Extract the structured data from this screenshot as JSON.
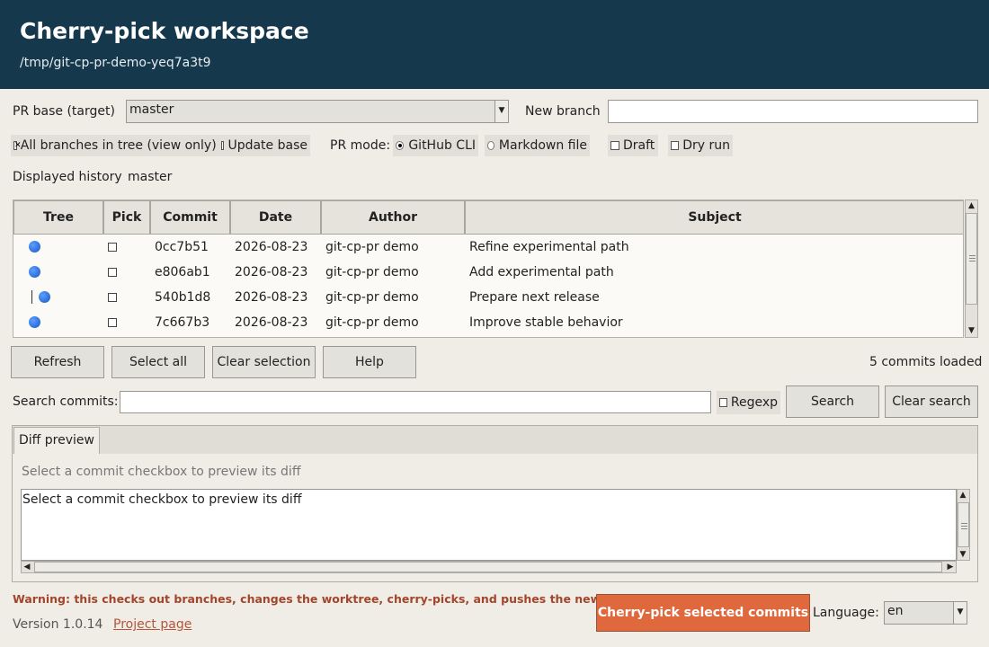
{
  "header": {
    "title": "Cherry-pick workspace",
    "repo_path": "/tmp/git-cp-pr-demo-yeq7a3t9"
  },
  "form": {
    "pr_base_label": "PR base (target)",
    "pr_base_value": "master",
    "new_branch_label": "New branch",
    "new_branch_value": "",
    "all_branches_label": "All branches in tree (view only)",
    "update_base_label": "Update base",
    "pr_mode_label": "PR mode:",
    "github_cli_label": "GitHub CLI",
    "markdown_file_label": "Markdown file",
    "draft_label": "Draft",
    "dry_run_label": "Dry run",
    "displayed_history_label": "Displayed history",
    "displayed_history_value": "master"
  },
  "table": {
    "columns": [
      "Tree",
      "Pick",
      "Commit",
      "Date",
      "Author",
      "Subject"
    ],
    "rows": [
      {
        "tree": "dot",
        "commit": "0cc7b51",
        "date": "2026-08-23",
        "author": "git-cp-pr demo",
        "subject": "Refine experimental path"
      },
      {
        "tree": "dot",
        "commit": "e806ab1",
        "date": "2026-08-23",
        "author": "git-cp-pr demo",
        "subject": "Add experimental path"
      },
      {
        "tree": "bar-dot",
        "commit": "540b1d8",
        "date": "2026-08-23",
        "author": "git-cp-pr demo",
        "subject": "Prepare next release"
      },
      {
        "tree": "dot",
        "commit": "7c667b3",
        "date": "2026-08-23",
        "author": "git-cp-pr demo",
        "subject": "Improve stable behavior"
      }
    ]
  },
  "actions": {
    "refresh": "Refresh",
    "select_all": "Select all",
    "clear_selection": "Clear selection",
    "help": "Help",
    "status": "5 commits loaded"
  },
  "search": {
    "label": "Search commits:",
    "value": "",
    "regexp_label": "Regexp",
    "search_button": "Search",
    "clear_button": "Clear search"
  },
  "diff": {
    "tab_label": "Diff preview",
    "hint": "Select a commit checkbox to preview its diff",
    "content": "Select a commit checkbox to preview its diff"
  },
  "footer": {
    "warning": "Warning: this checks out branches, changes the worktree, cherry-picks, and pushes the new branch.",
    "version": "Version 1.0.14",
    "project_link": "Project page",
    "cherry_pick_button": "Cherry-pick selected commits",
    "language_label": "Language:",
    "language_value": "en"
  },
  "colors": {
    "header_bg": "#16384d",
    "primary_button": "#e0683d",
    "warning_text": "#a3452a",
    "commit_dot": "#1a55c8"
  }
}
